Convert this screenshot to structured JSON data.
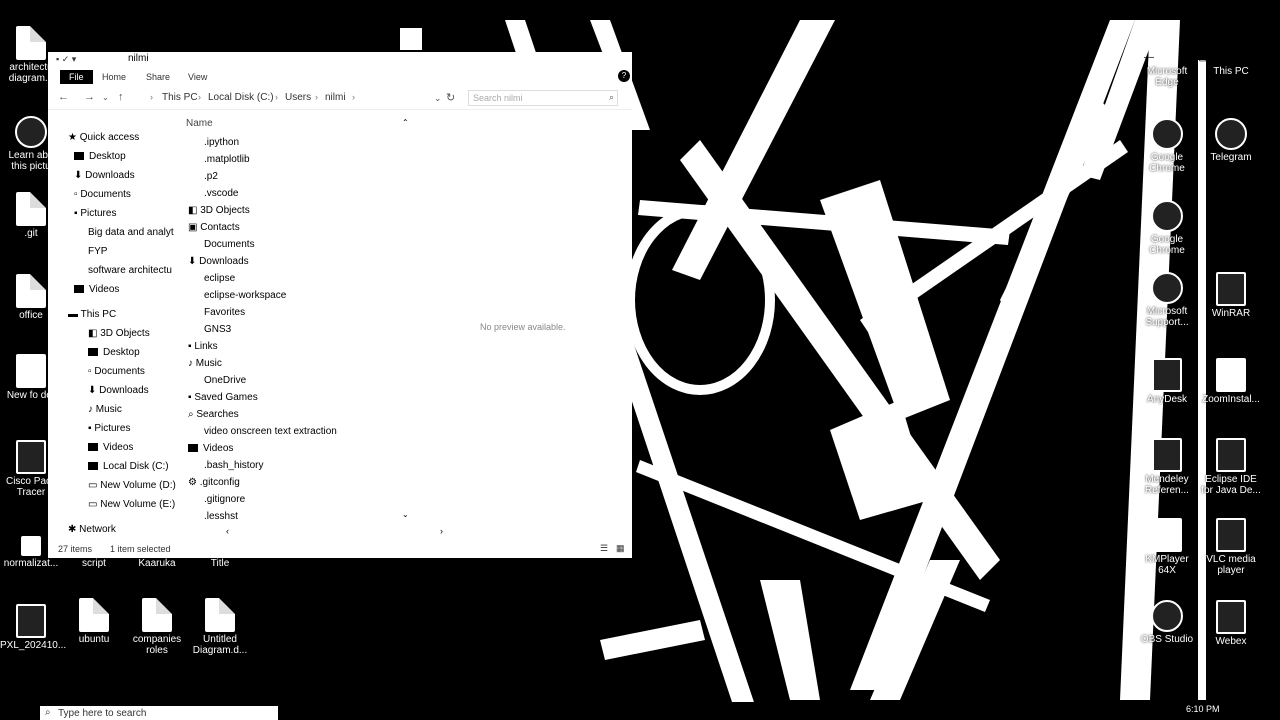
{
  "explorer": {
    "window_title": "nilmi",
    "ribbon_tabs": [
      "File",
      "Home",
      "Share",
      "View"
    ],
    "breadcrumb": [
      "This PC",
      "Local Disk (C:)",
      "Users",
      "nilmi"
    ],
    "search_placeholder": "Search nilmi",
    "nav": {
      "quick_access_label": "Quick access",
      "quick_access": [
        "Desktop",
        "Downloads",
        "Documents",
        "Pictures",
        "Big data and analyt",
        "FYP",
        "software architectu",
        "Videos"
      ],
      "this_pc_label": "This PC",
      "this_pc": [
        "3D Objects",
        "Desktop",
        "Documents",
        "Downloads",
        "Music",
        "Pictures",
        "Videos",
        "Local Disk (C:)",
        "New Volume (D:)",
        "New Volume (E:)"
      ],
      "network_label": "Network"
    },
    "column_header": "Name",
    "files": [
      ".ipython",
      ".matplotlib",
      ".p2",
      ".vscode",
      "3D Objects",
      "Contacts",
      "Documents",
      "Downloads",
      "eclipse",
      "eclipse-workspace",
      "Favorites",
      "GNS3",
      "Links",
      "Music",
      "OneDrive",
      "Saved Games",
      "Searches",
      "video onscreen text extraction",
      "Videos",
      ".bash_history",
      ".gitconfig",
      ".gitignore",
      ".lesshst"
    ],
    "preview_message": "No preview available.",
    "status_items": "27 items",
    "status_selected": "1 item selected"
  },
  "desktop_icons": {
    "left": [
      {
        "label": "architectu diagram..."
      },
      {
        "label": "Learn abo this pictu"
      },
      {
        "label": ".git"
      },
      {
        "label": "office"
      },
      {
        "label": "New fo der"
      },
      {
        "label": "Cisco Pack Tracer"
      },
      {
        "label": "normalizat..."
      },
      {
        "label": "script"
      },
      {
        "label": "Kaaruka"
      },
      {
        "label": "Title"
      },
      {
        "label": "PXL_202410..."
      },
      {
        "label": "ubuntu"
      },
      {
        "label": "companies roles"
      },
      {
        "label": "Untitled Diagram.d..."
      }
    ],
    "right": [
      {
        "label": "Microsoft Edge"
      },
      {
        "label": "This PC"
      },
      {
        "label": "Google Chrome"
      },
      {
        "label": "Telegram"
      },
      {
        "label": "Google Chrome"
      },
      {
        "label": "Microsoft Support..."
      },
      {
        "label": "WinRAR"
      },
      {
        "label": "AnyDesk"
      },
      {
        "label": "ZoomInstal..."
      },
      {
        "label": "Mendeley Referen..."
      },
      {
        "label": "Eclipse IDE for Java De..."
      },
      {
        "label": "KMPlayer 64X"
      },
      {
        "label": "VLC media player"
      },
      {
        "label": "OBS Studio"
      },
      {
        "label": "Webex"
      }
    ]
  },
  "taskbar": {
    "search_placeholder": "Type here to search",
    "clock": "6:10 PM"
  }
}
